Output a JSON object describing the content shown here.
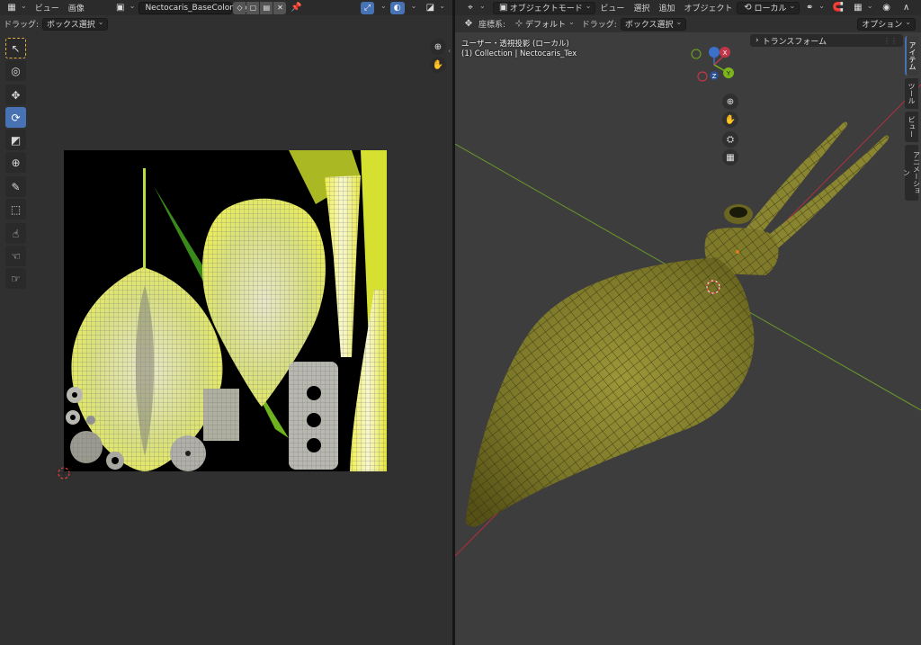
{
  "uv_editor": {
    "header": {
      "menu_view": "ビュー",
      "menu_image": "画像",
      "image_name": "Nectocaris_BaseColor.png"
    },
    "toolbar_row": {
      "drag_label": "ドラッグ:",
      "drag_mode": "ボックス選択"
    }
  },
  "viewport": {
    "header": {
      "mode": "オブジェクトモード",
      "menu_view": "ビュー",
      "menu_select": "選択",
      "menu_add": "追加",
      "menu_object": "オブジェクト",
      "transform_orientation": "ローカル"
    },
    "toolbar_row": {
      "coord_label": "座標系:",
      "coord_value": "デフォルト",
      "drag_label": "ドラッグ:",
      "drag_mode": "ボックス選択",
      "options": "オプション"
    },
    "overlay": {
      "view_name": "ユーザー・透視投影 (ローカル)",
      "collection": "(1) Collection | Nectocaris_Tex"
    },
    "gizmo": {
      "x": "X",
      "y": "Y",
      "z": "Z"
    },
    "n_panel": {
      "transform": "トランスフォーム",
      "tabs": [
        "アイテム",
        "ツール",
        "ビュー",
        "アニメーション"
      ]
    }
  },
  "colors": {
    "accent": "#4772b3",
    "mesh_yellow": "#8a8530",
    "axis_x": "#c2364a",
    "axis_y": "#7bb51b",
    "axis_z": "#3d70c9"
  }
}
